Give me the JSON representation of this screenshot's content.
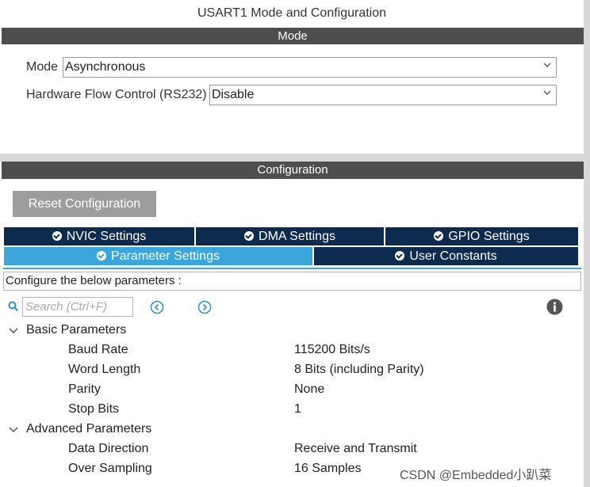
{
  "window_title": "USART1 Mode and Configuration",
  "mode_section": {
    "header": "Mode",
    "mode_label": "Mode",
    "mode_value": "Asynchronous",
    "hw_flow_label": "Hardware Flow Control (RS232)",
    "hw_flow_value": "Disable"
  },
  "config_section": {
    "header": "Configuration",
    "reset_button": "Reset Configuration",
    "tabs_row1": [
      {
        "label": "NVIC Settings"
      },
      {
        "label": "DMA Settings"
      },
      {
        "label": "GPIO Settings"
      }
    ],
    "tabs_row2": [
      {
        "label": "Parameter Settings",
        "active": true
      },
      {
        "label": "User Constants",
        "active": false
      }
    ],
    "description": "Configure the below parameters :",
    "search_placeholder": "Search (Ctrl+F)"
  },
  "parameters": {
    "basic": {
      "label": "Basic Parameters",
      "rows": [
        {
          "name": "Baud Rate",
          "value": "115200 Bits/s"
        },
        {
          "name": "Word Length",
          "value": "8 Bits (including Parity)"
        },
        {
          "name": "Parity",
          "value": "None"
        },
        {
          "name": "Stop Bits",
          "value": "1"
        }
      ]
    },
    "advanced": {
      "label": "Advanced Parameters",
      "rows": [
        {
          "name": "Data Direction",
          "value": "Receive and Transmit"
        },
        {
          "name": "Over Sampling",
          "value": "16 Samples"
        }
      ]
    }
  },
  "watermark": "CSDN @Embedded小趴菜",
  "colors": {
    "header_bg": "#4e4e4e",
    "tab_bg": "#0d2a4f",
    "tab_active_bg": "#3aa6db",
    "reset_btn_bg": "#9d9d9d",
    "icon_blue": "#2a8fd6"
  },
  "icons": [
    "chevron-down-icon",
    "check-circle-icon",
    "search-icon",
    "arrow-left-circle-icon",
    "arrow-right-circle-icon",
    "info-icon",
    "collapse-chevron-icon"
  ]
}
